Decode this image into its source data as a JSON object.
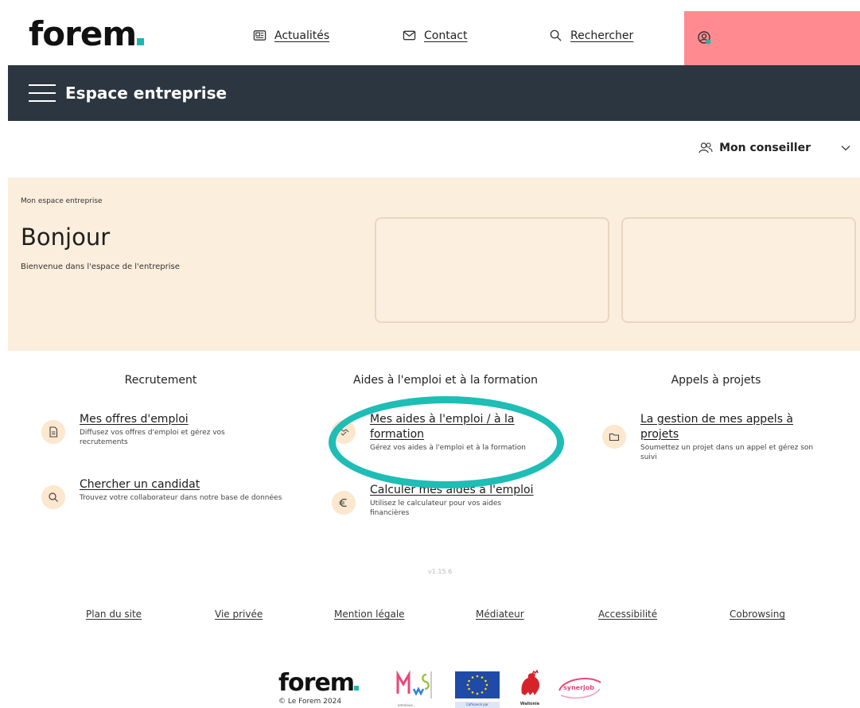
{
  "header": {
    "logo": "forem",
    "links": [
      {
        "label": "Actualités"
      },
      {
        "label": "Contact"
      },
      {
        "label": "Rechercher"
      }
    ]
  },
  "navbar": {
    "title": "Espace entreprise"
  },
  "conseiller": {
    "label": "Mon conseiller"
  },
  "hero": {
    "breadcrumb": "Mon espace entreprise",
    "greeting": "Bonjour",
    "welcome": "Bienvenue dans l'espace de l'entreprise"
  },
  "columns": [
    {
      "title": "Recrutement",
      "items": [
        {
          "title": "Mes offres d'emploi",
          "desc": "Diffusez vos offres d'emploi et gérez vos recrutements",
          "icon": "document-icon"
        },
        {
          "title": "Chercher un candidat",
          "desc": "Trouvez votre collaborateur dans notre base de données",
          "icon": "search-icon"
        }
      ]
    },
    {
      "title": "Aides à l'emploi et à la formation",
      "items": [
        {
          "title": "Mes aides à l'emploi / à la formation",
          "desc": "Gérez vos aides à l'emploi et à la formation",
          "icon": "handshake-icon"
        },
        {
          "title": "Calculer mes aides à l'emploi",
          "desc": "Utilisez le calculateur pour vos aides financières",
          "icon": "euro-icon"
        }
      ]
    },
    {
      "title": "Appels à projets",
      "items": [
        {
          "title": "La gestion de mes appels à projets",
          "desc": "Soumettez un projet dans un appel et gérez son suivi",
          "icon": "folder-icon"
        }
      ]
    }
  ],
  "version": "v1.15.6",
  "footer": {
    "links": [
      "Plan du site",
      "Vie privée",
      "Mention légale",
      "Médiateur",
      "Accessibilité",
      "Cobrowsing"
    ],
    "logo": "forem",
    "copyright": "© Le Forem 2024",
    "partners": {
      "mws_caption": "emmieux...",
      "eu_caption": "Cofinancé par",
      "wallonie_caption": "Wallonie",
      "synerjob": "synerjob"
    }
  },
  "colors": {
    "navbar": "#2b3640",
    "hero": "#fbeedd",
    "login_block": "#ff8b90",
    "highlight": "#1ebdb6",
    "brand_dot": "#1fb5b0",
    "icon_bubble": "#fce7cf"
  }
}
